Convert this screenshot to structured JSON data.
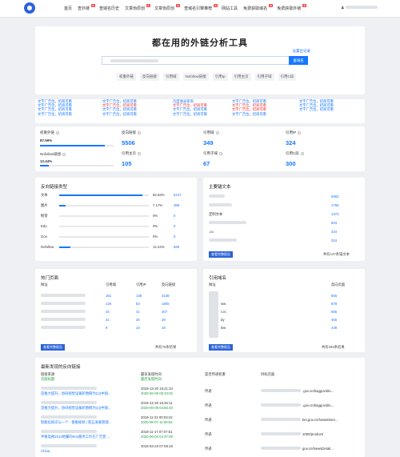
{
  "nav": {
    "items": [
      {
        "label": "首页",
        "badge": ""
      },
      {
        "label": "查外链",
        "badge": "热"
      },
      {
        "label": "查域名历史",
        "badge": ""
      },
      {
        "label": "文章伪原创",
        "badge": "热"
      },
      {
        "label": "文章伪原创",
        "badge": "热"
      },
      {
        "label": "查域名引擎推荐",
        "badge": "热"
      },
      {
        "label": "网站工具",
        "badge": ""
      },
      {
        "label": "免费获取域名",
        "badge": "热"
      },
      {
        "label": "免费获取外链",
        "badge": "新"
      }
    ],
    "user": "≜"
  },
  "hero": {
    "title": "都在用的外链分析工具",
    "link": "设置出记录",
    "search_btn": "查域名",
    "chips": [
      "权重外链",
      "反向链接",
      "引用域",
      "Nofollow链接",
      "引用Ip",
      "引用主页",
      "引用子域",
      "引用C段"
    ]
  },
  "ads": {
    "text": "文字广告位，招商可看",
    "red_text": "文字广告位，招商可看",
    "mid": "百度收录查询"
  },
  "stats": {
    "weight_label": "权重外链",
    "weight_pct": "87.56%",
    "weight_fill": 0.8756,
    "nofollow_label": "Nofollow链接",
    "nofollow_pct": "12.44%",
    "nofollow_fill": 0.1244,
    "backlinks_label": "反向链接",
    "backlinks": "5506",
    "refdomains_label": "引用域",
    "refdomains": "349",
    "refip_label": "引用IP",
    "refip": "324",
    "refhome_label": "引用主页",
    "refhome": "105",
    "refsub_label": "引用子域",
    "refsub": "67",
    "refc_label": "引用C段",
    "refc": "300"
  },
  "link_types": {
    "title": "反向链接类型",
    "rows": [
      {
        "name": "文本",
        "pct": "92.83%",
        "count": "5147",
        "fill": 0.9283
      },
      {
        "name": "图片",
        "pct": "7.17%",
        "count": "398",
        "fill": 0.0717
      },
      {
        "name": "框架",
        "pct": "0%",
        "count": "0",
        "fill": 0
      },
      {
        "name": "Edu",
        "pct": "0%",
        "count": "0",
        "fill": 0
      },
      {
        "name": "Gov",
        "pct": "0%",
        "count": "0",
        "fill": 0
      },
      {
        "name": "Nofollow",
        "pct": "12.44%",
        "count": "685",
        "fill": 0.1244
      }
    ]
  },
  "anchors": {
    "title": "主要锚文本",
    "rows": [
      {
        "text": "",
        "count": "5962"
      },
      {
        "text": "",
        "count": "1768"
      },
      {
        "text": "定制文本",
        "count": "1473"
      },
      {
        "text": "",
        "count": "603"
      },
      {
        "text": ".co",
        "count": "334"
      },
      {
        "text": "",
        "count": "324"
      }
    ],
    "btn": "查看完整报告",
    "footer": "共有147条锚文本"
  },
  "hot_pages": {
    "title": "热门页面",
    "headers": [
      "网址",
      "引用域",
      "引用IP",
      "反向链接"
    ],
    "rows": [
      [
        "151",
        "138",
        "3138"
      ],
      [
        "125",
        "83",
        "1805"
      ],
      [
        "34",
        "41",
        "207"
      ],
      [
        "21",
        "25",
        "28"
      ],
      [
        "9",
        "10",
        "19"
      ]
    ],
    "btn": "查看完整报告",
    "footer": "共有76条结果"
  },
  "ref_domains": {
    "title": "引用域名",
    "headers": [
      "网址",
      "反向页面"
    ],
    "rows": [
      {
        "site": "",
        "count": "665"
      },
      {
        "site": "ww",
        "count": "878"
      },
      {
        "site": "l.cn",
        "count": "586"
      },
      {
        "site": "dy",
        "count": "456"
      },
      {
        "site": "live",
        "count": "438"
      }
    ],
    "btn": "查看完整报告",
    "footer": "共有294条结果"
  },
  "recent": {
    "title": "最新发现的反向链接",
    "headers": [
      "链接来源",
      "最早发现时间",
      "是否传递权重",
      "目标页面"
    ],
    "subheaders": [
      "页面标题",
      "最后发现时间"
    ],
    "rows": [
      {
        "title": "首推大提升，协同视觉设备轮胎碗为(1)(中国...",
        "first": "2019-12-20 15:21:34",
        "last": "2020-06-09 05:10:02",
        "pass": "传递",
        "target": ".gov.cn/baggov/dis..."
      },
      {
        "title": "首推大提升，协同视觉设备轮胎碗为(1)(中国...",
        "first": "2019-12-20 15:46:11",
        "last": "2020-06-09 04:50:40",
        "pass": "传递",
        "target": ".gov.cn/baggov/dis..."
      },
      {
        "title": "智能化知识与一个 · 香推规划 | 第五发展管理...",
        "first": "2019-11-22 00:03:42",
        "last": "2020-06-07 11:00:52",
        "pass": "传递",
        "target": "bei.gov.cn/NewsMore..."
      },
      {
        "title": "手推电视2013地量的Sns服务工作在广告营 ...",
        "first": "2019-11-17 07:07:51",
        "last": "2020-06-04 04:37:09",
        "pass": "传递",
        "target": "1000/product/"
      },
      {
        "title": "China",
        "first": "2019-03-23 07:08:18",
        "last": "",
        "pass": "传递",
        "target": "gov.cn/NewsDetail..."
      }
    ]
  }
}
